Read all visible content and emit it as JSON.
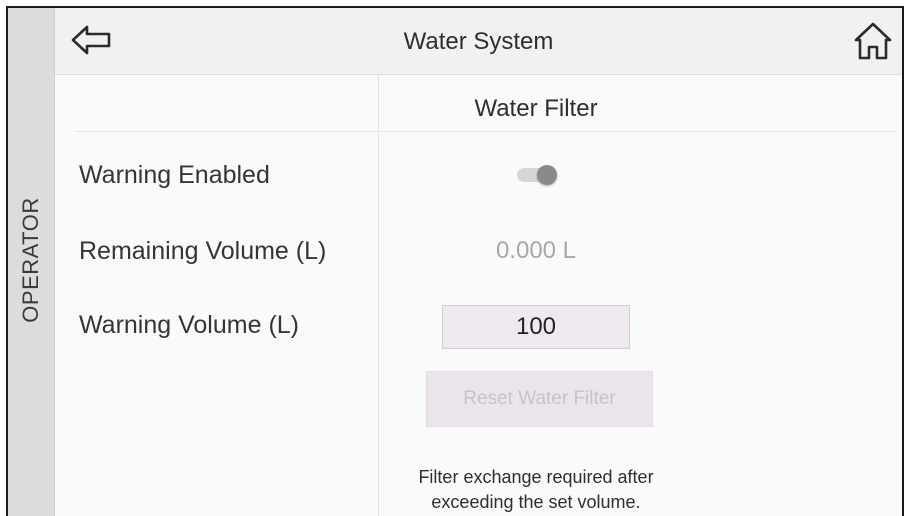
{
  "sidebar": {
    "role_label": "OPERATOR"
  },
  "header": {
    "title": "Water System",
    "back_icon": "arrow-left-outline-icon",
    "home_icon": "home-outline-icon"
  },
  "section": {
    "title": "Water Filter"
  },
  "settings": {
    "warning_enabled_label": "Warning Enabled",
    "warning_enabled_state": false,
    "remaining_volume_label": "Remaining Volume (L)",
    "remaining_volume_value": "0.000 L",
    "warning_volume_label": "Warning Volume (L)",
    "warning_volume_value": "100"
  },
  "reset_button": {
    "label": "Reset Water Filter",
    "enabled": false
  },
  "note": {
    "line1": "Filter exchange required after",
    "line2": "exceeding the set volume."
  },
  "colors": {
    "side_tab_bg": "#dcdcdc",
    "header_bg": "#f1f1f1",
    "input_bg": "#efe8ef",
    "disabled_text": "#c9c2c9",
    "muted_value": "#a8a8a8"
  }
}
